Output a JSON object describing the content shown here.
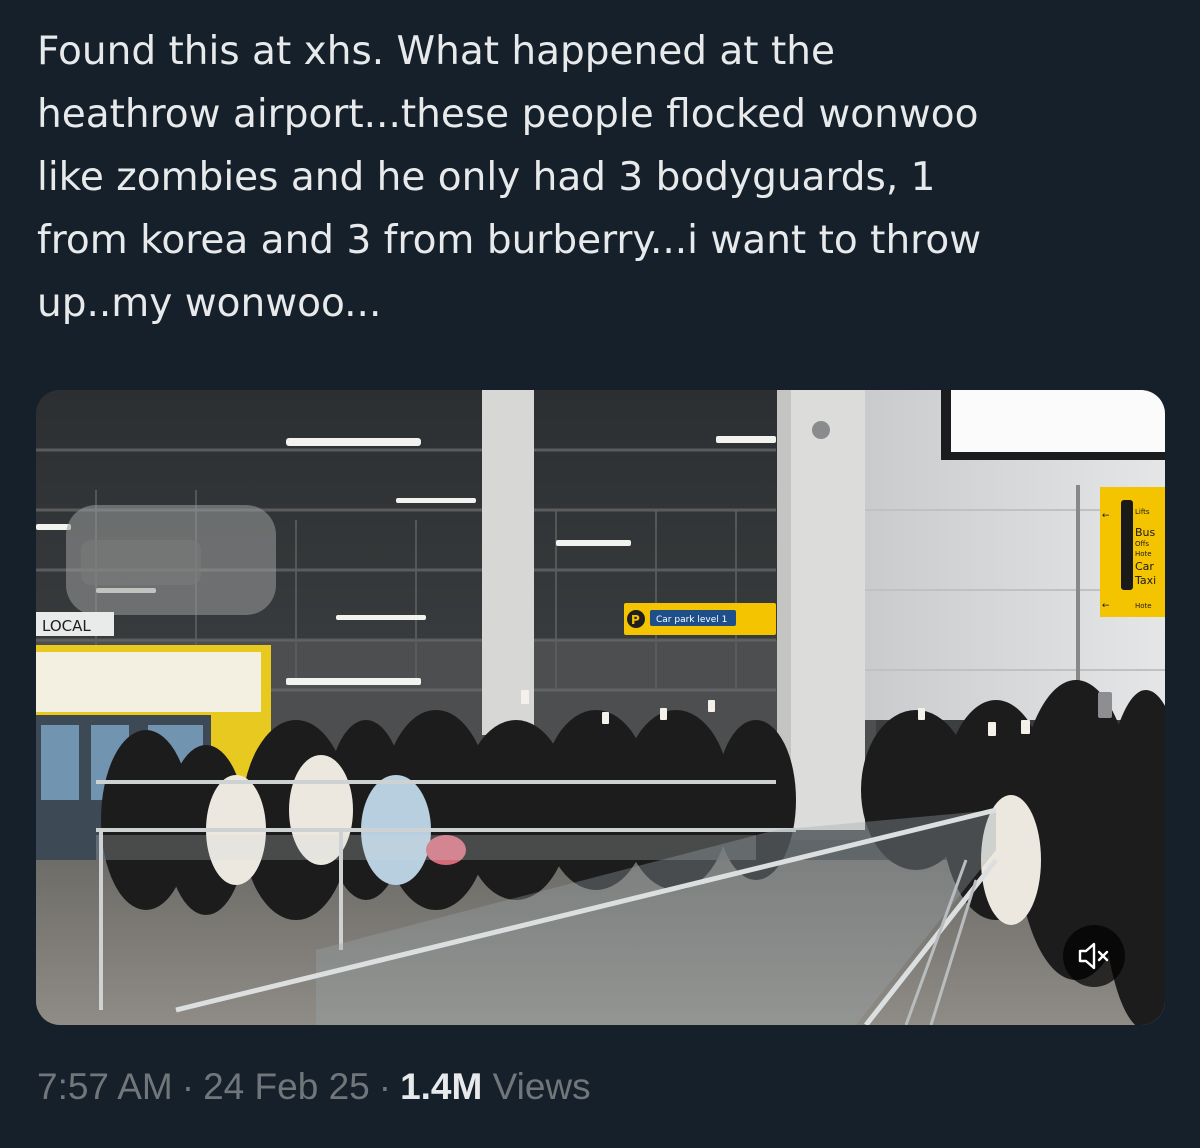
{
  "tweet": {
    "text": "Found this at xhs. What happened at the\nheathrow airport...these people flocked wonwoo\nlike zombies and he only had 3 bodyguards, 1\nfrom korea and 3 from burberry...i want to throw\nup..my wonwoo...",
    "time": "7:57 AM",
    "date": "24 Feb 25",
    "separator": "·",
    "views_count": "1.4M",
    "views_label": "Views"
  },
  "media": {
    "type": "video",
    "mute_icon": "speaker-muted-icon",
    "signs": {
      "local": "LOCAL",
      "car_park": "Car park level 1",
      "parking_letter": "P",
      "wayfinding": [
        "Lifts",
        "Bus",
        "Offs",
        "Hote",
        "Car",
        "Taxi",
        "Hote"
      ]
    }
  },
  "colors": {
    "background": "#15202b",
    "text": "#e7e9ea",
    "muted": "#71767b",
    "sign_yellow": "#f5c400"
  }
}
